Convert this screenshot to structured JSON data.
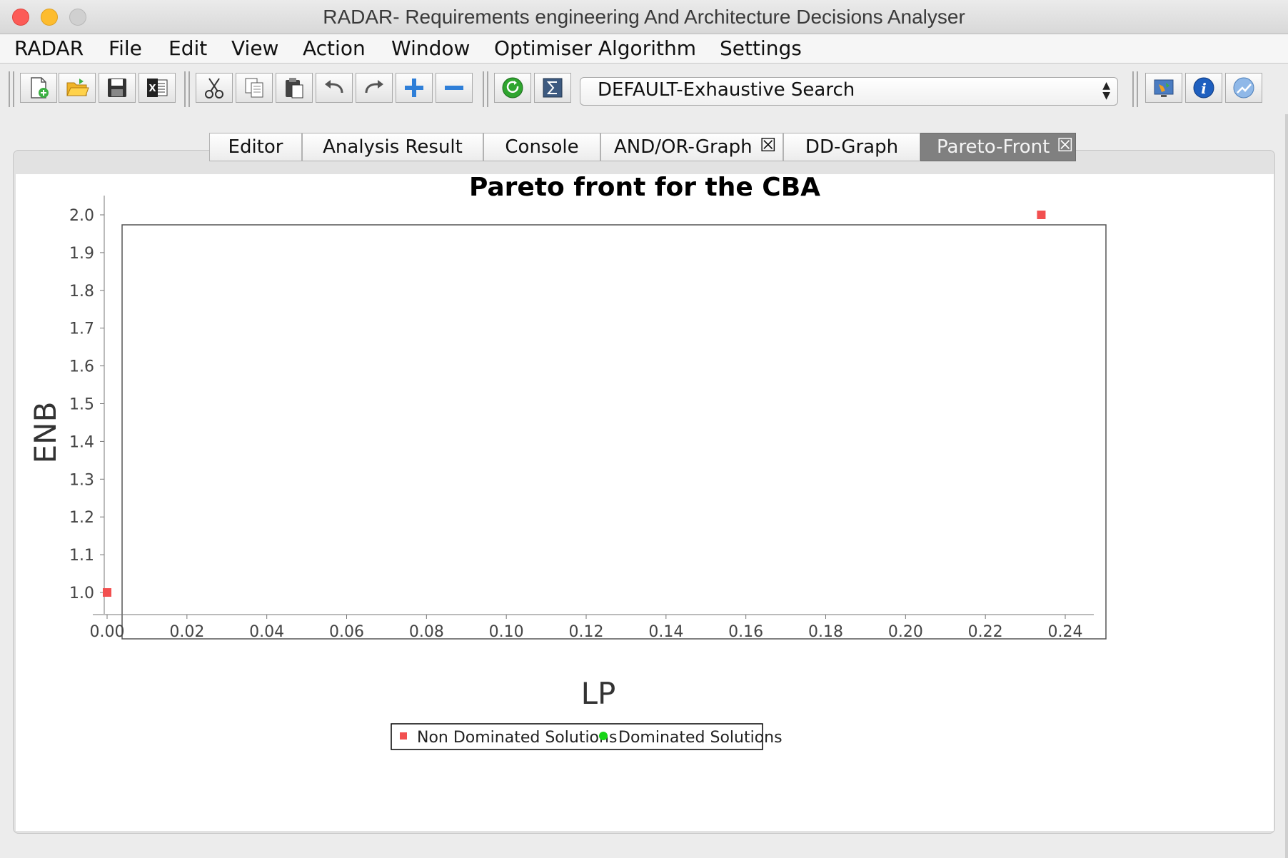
{
  "window": {
    "title": "RADAR- Requirements engineering And Architecture Decisions Analyser"
  },
  "menubar": {
    "items": [
      "RADAR",
      "File",
      "Edit",
      "View",
      "Action",
      "Window",
      "Optimiser Algorithm",
      "Settings"
    ]
  },
  "toolbar": {
    "buttons": [
      "new-file-icon",
      "open-folder-icon",
      "save-icon",
      "excel-export-icon",
      "cut-icon",
      "copy-icon",
      "paste-icon",
      "undo-icon",
      "redo-icon",
      "zoom-in-icon",
      "zoom-out-icon",
      "refresh-icon",
      "sigma-icon",
      "world-icon",
      "info-icon",
      "chart-icon"
    ],
    "algorithm": "DEFAULT-Exhaustive Search"
  },
  "tabs": [
    {
      "label": "Editor",
      "closable": false,
      "active": false
    },
    {
      "label": "Analysis Result",
      "closable": false,
      "active": false
    },
    {
      "label": "Console",
      "closable": false,
      "active": false
    },
    {
      "label": "AND/OR-Graph",
      "closable": true,
      "active": false
    },
    {
      "label": "DD-Graph",
      "closable": false,
      "active": false
    },
    {
      "label": "Pareto-Front",
      "closable": true,
      "active": true
    }
  ],
  "chart_data": {
    "type": "scatter",
    "title": "Pareto front for the CBA",
    "xlabel": "LP",
    "ylabel": "ENB",
    "xlim": [
      0.0,
      0.24
    ],
    "ylim": [
      1.0,
      2.0
    ],
    "x_ticks": [
      "0.00",
      "0.02",
      "0.04",
      "0.06",
      "0.08",
      "0.10",
      "0.12",
      "0.14",
      "0.16",
      "0.18",
      "0.20",
      "0.22",
      "0.24"
    ],
    "y_ticks": [
      "1.0",
      "1.1",
      "1.2",
      "1.3",
      "1.4",
      "1.5",
      "1.6",
      "1.7",
      "1.8",
      "1.9",
      "2.0"
    ],
    "grid": false,
    "legend_position": "bottom",
    "series": [
      {
        "name": "Non Dominated Solutions",
        "marker": "square",
        "color": "#f25050",
        "points": [
          {
            "x": 0.0,
            "y": 1.0
          },
          {
            "x": 0.234,
            "y": 2.0
          }
        ]
      },
      {
        "name": "Dominated Solutions",
        "marker": "circle",
        "color": "#17d417",
        "points": []
      }
    ]
  }
}
